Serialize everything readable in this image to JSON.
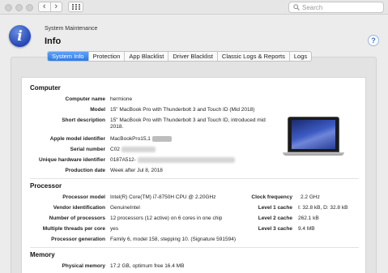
{
  "window": {
    "search_placeholder": "Search",
    "back_glyph": "‹",
    "forward_glyph": "›"
  },
  "pane": {
    "title": "System Maintenance",
    "heading": "Info",
    "help_label": "?",
    "icon_glyph": "i"
  },
  "tabs": [
    {
      "label": "System Info",
      "active": true
    },
    {
      "label": "Protection",
      "active": false
    },
    {
      "label": "App Blacklist",
      "active": false
    },
    {
      "label": "Driver Blacklist",
      "active": false
    },
    {
      "label": "Classic Logs & Reports",
      "active": false
    },
    {
      "label": "Logs",
      "active": false
    }
  ],
  "computer": {
    "title": "Computer",
    "rows": [
      {
        "label": "Computer name",
        "value": "hermione"
      },
      {
        "label": "Model",
        "value": "15\" MacBook Pro with Thunderbolt 3 and Touch ID (Mid 2018)"
      },
      {
        "label": "Short description",
        "value": "15\" MacBook Pro with Thunderbolt 3 and Touch ID, introduced mid 2018."
      },
      {
        "label": "Apple model identifier",
        "value": "MacBookPro15,1"
      },
      {
        "label": "Serial number",
        "value": "C02"
      },
      {
        "label": "Unique hardware identifier",
        "value": "0187A512-"
      },
      {
        "label": "Production date",
        "value": "Week after Jul 8, 2018"
      }
    ]
  },
  "processor": {
    "title": "Processor",
    "rows": [
      {
        "label": "Processor model",
        "value": "Intel(R) Core(TM) i7-8750H CPU @ 2.20GHz"
      },
      {
        "label": "Vendor identification",
        "value": "GenuineIntel"
      },
      {
        "label": "Number of processors",
        "value": "12 processors (12 active) on 6 cores in one chip"
      },
      {
        "label": "Multiple threads per core",
        "value": "yes"
      },
      {
        "label": "Processor generation",
        "value": "Family 6, model 158, stepping 10. (Signature 591594)"
      }
    ],
    "right_rows": [
      {
        "label": "Clock frequency",
        "value": "2.2 GHz"
      },
      {
        "label": "Level 1 cache",
        "value": "I: 32.8 kB, D: 32.8 kB"
      },
      {
        "label": "Level 2 cache",
        "value": "262.1 kB"
      },
      {
        "label": "Level 3 cache",
        "value": "9.4 MB"
      }
    ]
  },
  "memory": {
    "title": "Memory",
    "rows": [
      {
        "label": "Physical memory",
        "value": "17.2 GB, optimum free 16.4 MB"
      }
    ]
  }
}
